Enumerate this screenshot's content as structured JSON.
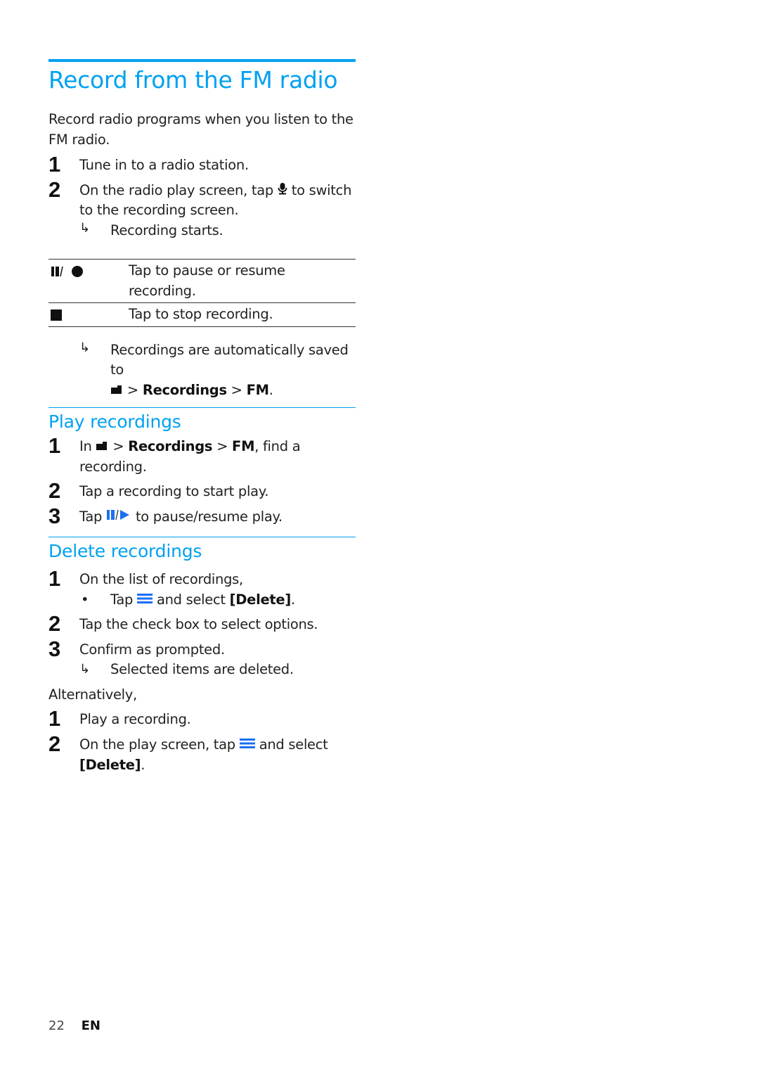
{
  "section1": {
    "title": "Record from the FM radio",
    "intro": "Record radio programs when you listen to the FM radio.",
    "steps": [
      {
        "num": "1",
        "text": "Tune in to a radio station."
      },
      {
        "num": "2",
        "text_before": "On the radio play screen, tap",
        "icon": "microphone-icon",
        "text_after": "to switch to the recording screen."
      }
    ],
    "result": "Recording starts.",
    "keys": [
      {
        "icon": "pause-record-icon",
        "desc": "Tap to pause or resume recording."
      },
      {
        "icon": "stop-icon",
        "desc": "Tap to stop recording."
      }
    ],
    "saved_note": "Recordings are automatically saved to",
    "path": {
      "sep": ">",
      "folder": "Recordings",
      "sub": "FM",
      "end": "."
    }
  },
  "section2": {
    "title": "Play recordings",
    "steps": [
      {
        "num": "1",
        "prefix": "In",
        "folder": "Recordings",
        "sub": "FM",
        "suffix": ", find a recording."
      },
      {
        "num": "2",
        "text": "Tap a recording to start play."
      },
      {
        "num": "3",
        "prefix": "Tap",
        "suffix": "to pause/resume play."
      }
    ]
  },
  "section3": {
    "title": "Delete recordings",
    "steps": [
      {
        "num": "1",
        "text": "On the list of recordings,"
      },
      {
        "num": "2",
        "text": "Tap the check box to select options."
      },
      {
        "num": "3",
        "text": "Confirm as prompted."
      }
    ],
    "bullet": {
      "prefix": "Tap",
      "mid": "and select",
      "option": "[Delete]",
      "end": "."
    },
    "result": "Selected items are deleted.",
    "alternatively": "Alternatively,",
    "alt_steps": [
      {
        "num": "1",
        "text": "Play a recording."
      },
      {
        "num": "2",
        "prefix": "On the play screen, tap",
        "mid": "and select",
        "option": "[Delete]",
        "end": "."
      }
    ]
  },
  "footer": {
    "page": "22",
    "lang": "EN"
  },
  "colors": {
    "accent": "#00a1f1",
    "text": "#222222"
  }
}
